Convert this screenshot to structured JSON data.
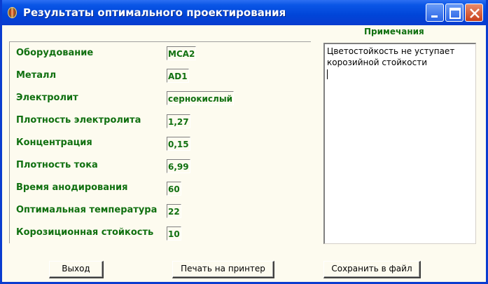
{
  "window": {
    "title": "Результаты оптимального проектирования",
    "icon": "app-icon",
    "controls": {
      "minimize": "minimize-icon",
      "maximize": "maximize-icon",
      "close": "close-icon"
    }
  },
  "params": [
    {
      "label": "Оборудование",
      "value": "МСА2"
    },
    {
      "label": "Металл",
      "value": "AD1"
    },
    {
      "label": "Электролит",
      "value": "сернокислый"
    },
    {
      "label": "Плотность электролита",
      "value": "1,27"
    },
    {
      "label": "Концентрация",
      "value": "0,15"
    },
    {
      "label": "Плотность тока",
      "value": "6,99"
    },
    {
      "label": "Время анодирования",
      "value": "60"
    },
    {
      "label": "Оптимальная температура",
      "value": "22"
    },
    {
      "label": "Корозиционная стойкость",
      "value": "10"
    }
  ],
  "notes": {
    "title": "Примечания",
    "text": "Цветостойкость не уступает\nкорозийной стойкости"
  },
  "buttons": {
    "exit": "Выход",
    "print": "Печать на принтер",
    "save": "Сохранить в файл"
  },
  "colors": {
    "label_green": "#107010",
    "titlebar_blue": "#0a56e6",
    "window_bg": "#fdfbef",
    "close_red": "#c8401c"
  }
}
